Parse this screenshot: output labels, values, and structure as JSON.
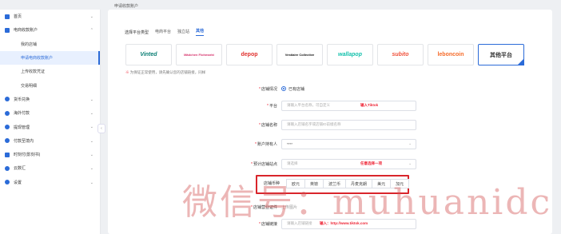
{
  "breadcrumb": "申请收款账户",
  "sidebar": {
    "items": [
      {
        "label": "首页",
        "icon": "home-icon",
        "color": "#2b6bd8",
        "chevron": "⌄"
      },
      {
        "label": "电商收款账户",
        "icon": "store-icon",
        "color": "#2b6bd8",
        "chevron": "⌃",
        "children": [
          "我的店铺",
          "申请电商收款账户",
          "上传收款凭证",
          "交易明细"
        ]
      },
      {
        "label": "货币兑换",
        "icon": "exchange-icon",
        "color": "#2b6bd8",
        "chevron": "⌄"
      },
      {
        "label": "海外付款",
        "icon": "payment-icon",
        "color": "#2b6bd8",
        "chevron": "⌄"
      },
      {
        "label": "提现管理",
        "icon": "withdraw-icon",
        "color": "#2b6bd8",
        "chevron": "⌄"
      },
      {
        "label": "付款至境内",
        "icon": "transfer-icon",
        "color": "#2b6bd8",
        "chevron": "⌄"
      },
      {
        "label": "时刻付(影刻书)",
        "icon": "calendar-icon",
        "color": "#2b6bd8",
        "chevron": "⌄"
      },
      {
        "label": "云数汇",
        "icon": "cloud-icon",
        "color": "#2b6bd8",
        "chevron": "⌄"
      },
      {
        "label": "设置",
        "icon": "settings-icon",
        "color": "#2b6bd8",
        "chevron": "⌄"
      }
    ],
    "collapse": "‹"
  },
  "main": {
    "type_label": "选择平台类型",
    "tabs": [
      "电商平台",
      "独立站",
      "其他"
    ],
    "active_tab": 2,
    "platforms": [
      {
        "name": "Vinted",
        "color": "#0a7e74",
        "style": "italic"
      },
      {
        "name": "Mädchen Flohmarkt",
        "color": "#d6336c",
        "style": "normal"
      },
      {
        "name": "depop",
        "color": "#e0302d",
        "style": "normal"
      },
      {
        "name": "Vestiaire Collective",
        "color": "#111111",
        "style": "normal"
      },
      {
        "name": "wallapop",
        "color": "#13c1ac",
        "style": "italic"
      },
      {
        "name": "subito",
        "color": "#f0503a",
        "style": "italic"
      },
      {
        "name": "leboncoin",
        "color": "#f56b2a",
        "style": "normal"
      },
      {
        "name": "其他平台",
        "color": "#333333",
        "style": "normal",
        "selected": true
      }
    ],
    "tip_star": "※",
    "tip_text": "为保证正常使用，请先确认您的店铺链接，同样",
    "form": {
      "status_label": "店铺情况",
      "status_value": "已有店铺",
      "platform_label": "平台",
      "platform_placeholder": "请输入平台名称，可自定义",
      "platform_note": "输入Tiktok",
      "store_name_label": "店铺名称",
      "store_name_placeholder": "请输入店铺名字或店铺ID前缀名称",
      "holder_label": "账户持有人",
      "holder_value": "****",
      "country_label": "预计店铺站点",
      "country_placeholder": "请选择",
      "country_note": "任意选择一项",
      "currency_label": "店铺币种",
      "currencies": [
        "欧元",
        "英镑",
        "波兰币",
        "丹麦克朗",
        "美元",
        "加元"
      ],
      "upload_label": "店铺营业证件",
      "upload_value": "上传图片",
      "link_label": "店铺链接",
      "link_placeholder": "请输入店铺链接",
      "link_note": "输入：http://www.tiktok.com"
    }
  },
  "watermark": "微信号：muhuanidc"
}
